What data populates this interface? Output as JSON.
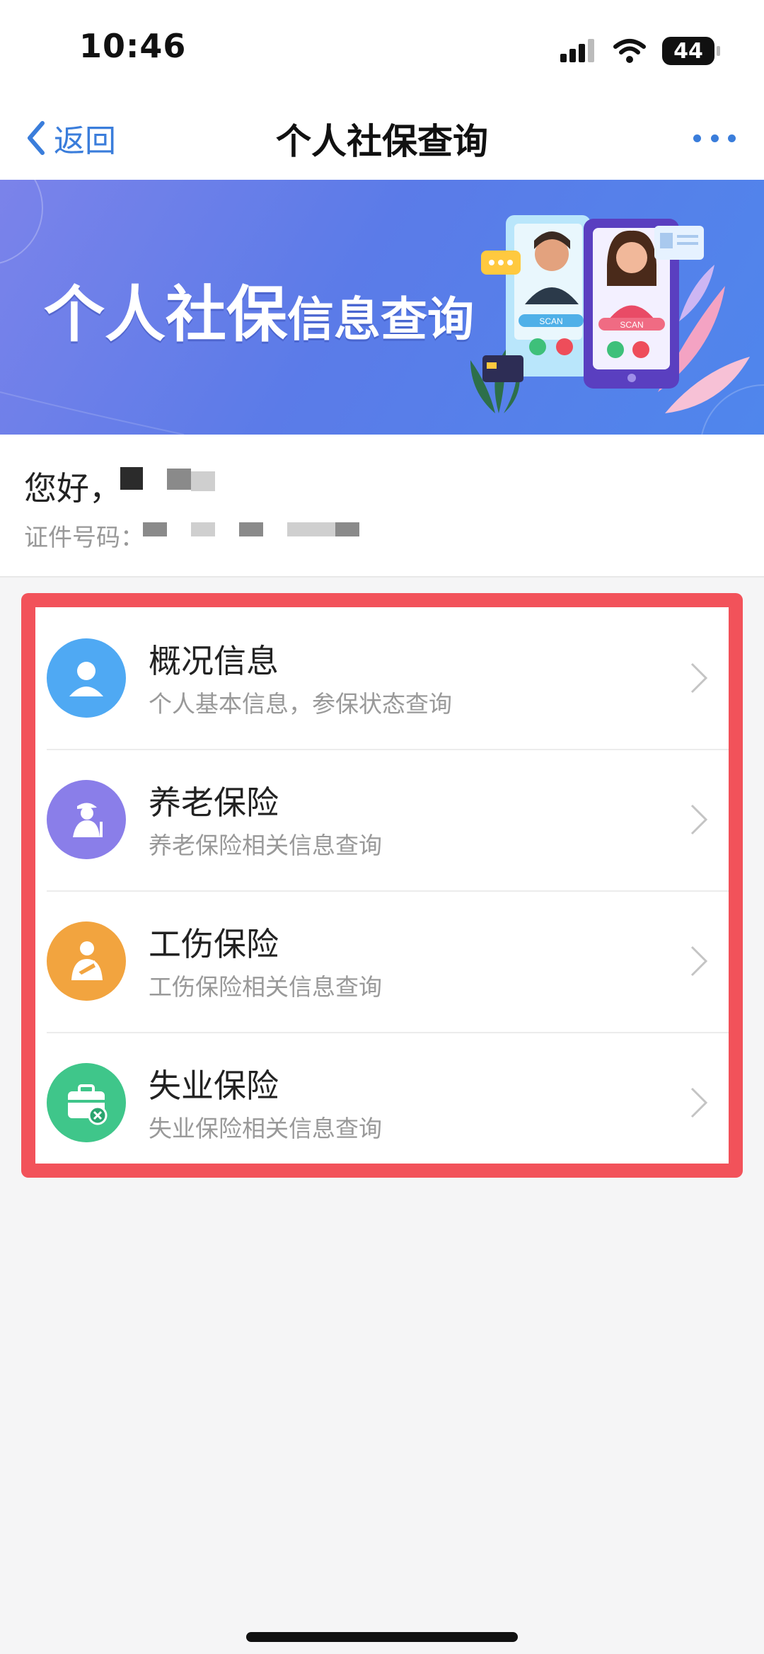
{
  "status_bar": {
    "time": "10:46",
    "battery": "44"
  },
  "nav": {
    "back_label": "返回",
    "title": "个人社保查询"
  },
  "banner": {
    "title_part1": "个人社保",
    "title_part2": "信息查询",
    "scan_label": "SCAN"
  },
  "greeting": {
    "hello": "您好，",
    "id_label": "证件号码："
  },
  "menu": {
    "items": [
      {
        "title": "概况信息",
        "subtitle": "个人基本信息，参保状态查询",
        "icon": "person-icon",
        "color": "#4fa9f3"
      },
      {
        "title": "养老保险",
        "subtitle": "养老保险相关信息查询",
        "icon": "elderly-icon",
        "color": "#8a7ee9"
      },
      {
        "title": "工伤保险",
        "subtitle": "工伤保险相关信息查询",
        "icon": "injury-icon",
        "color": "#f2a43f"
      },
      {
        "title": "失业保险",
        "subtitle": "失业保险相关信息查询",
        "icon": "briefcase-icon",
        "color": "#3fc68a"
      }
    ]
  },
  "colors": {
    "accent": "#3a7ddb",
    "highlight_border": "#f2525a"
  }
}
